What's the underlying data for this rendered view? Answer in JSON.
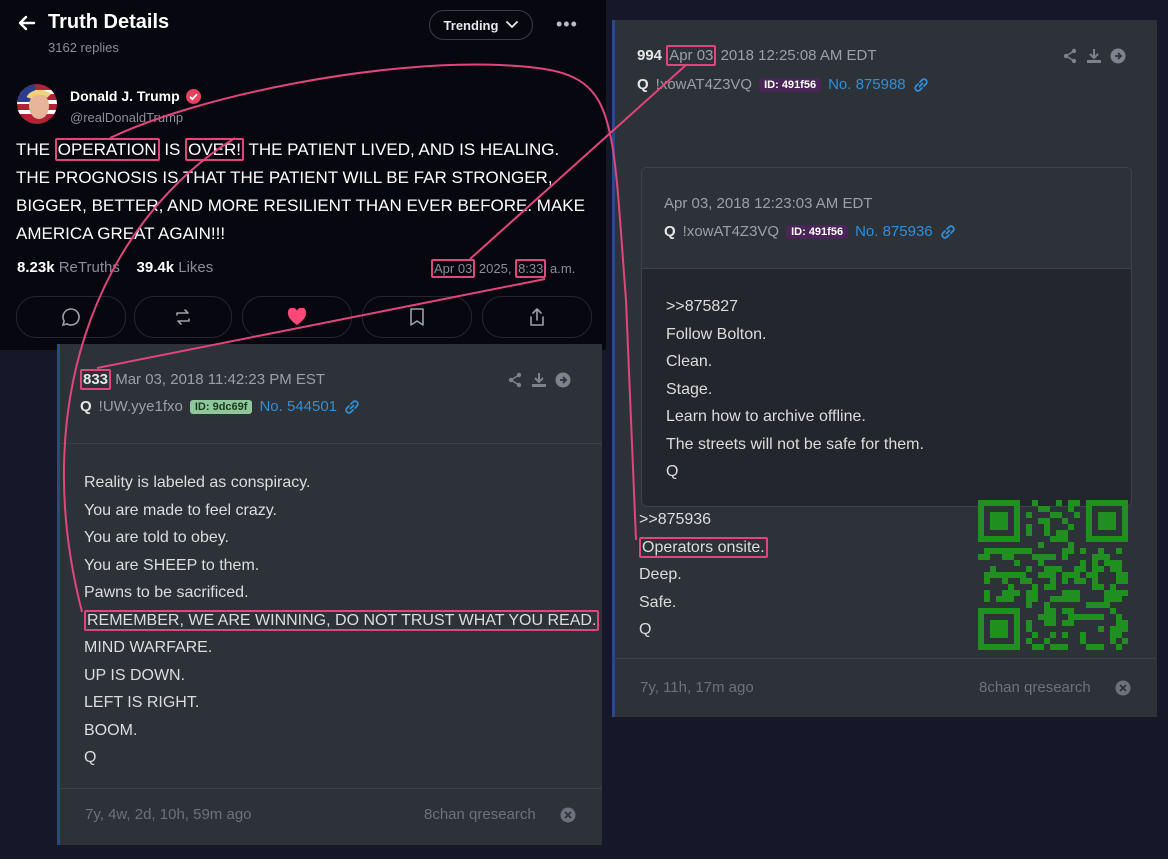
{
  "truth_header": {
    "title": "Truth Details",
    "replies": "3162 replies",
    "trending_label": "Trending",
    "more": "•••"
  },
  "author": {
    "name": "Donald J. Trump",
    "handle": "@realDonaldTrump"
  },
  "post": {
    "w1": "THE ",
    "h1": "OPERATION",
    "w2": " IS ",
    "h2": "OVER!",
    "w3": " THE PATIENT LIVED, AND IS HEALING. THE PROGNOSIS IS THAT THE PATIENT WILL BE FAR STRONGER, BIGGER, BETTER, AND MORE RESILIENT THAN EVER BEFORE. MAKE AMERICA GREAT AGAIN!!!"
  },
  "stats": {
    "retruths_count": "8.23k",
    "retruths_label": "ReTruths",
    "likes_count": "39.4k",
    "likes_label": "Likes"
  },
  "post_date": {
    "d1": "Apr 03",
    "d2": " 2025, ",
    "d3": "8:33",
    "d4": " a.m."
  },
  "card_left": {
    "num": "833",
    "date": "Mar 03, 2018 11:42:23 PM EST",
    "q": "Q",
    "trip": "!UW.yye1fxo",
    "id": "ID: 9dc69f",
    "post_no": "No. 544501",
    "lines": [
      "Reality is labeled as conspiracy.",
      "You are made to feel crazy.",
      "You are told to obey.",
      "You are SHEEP to them.",
      "Pawns to be sacrificed.",
      "REMEMBER, WE ARE WINNING, DO NOT TRUST WHAT YOU READ.",
      "MIND WARFARE.",
      "UP IS DOWN.",
      "LEFT IS RIGHT.",
      "BOOM.",
      "Q"
    ],
    "ago": "7y, 4w, 2d, 10h, 59m ago",
    "source": "8chan qresearch"
  },
  "card_right": {
    "num": "994",
    "date_hl": "Apr 03",
    "date_rest": "2018 12:25:08 AM EDT",
    "q": "Q",
    "trip": "!xowAT4Z3VQ",
    "id": "ID: 491f56",
    "post_no": "No. 875988",
    "quoted": {
      "date": "Apr 03, 2018 12:23:03 AM EDT",
      "q": "Q",
      "trip": "!xowAT4Z3VQ",
      "id": "ID: 491f56",
      "post_no": "No. 875936",
      "lines": [
        ">>875827",
        "Follow Bolton.",
        "Clean.",
        "Stage.",
        "Learn how to archive offline.",
        "The streets will not be safe for them.",
        "Q"
      ]
    },
    "lines": [
      ">>875936",
      "Operators onsite.",
      "Deep.",
      "Safe.",
      "Q"
    ],
    "ago": "7y, 11h, 17m ago",
    "source": "8chan qresearch"
  },
  "colors": {
    "highlight": "#e0457b",
    "link": "#2f8fd9",
    "qr": "#1f8f1f",
    "heart": "#ff4778"
  }
}
